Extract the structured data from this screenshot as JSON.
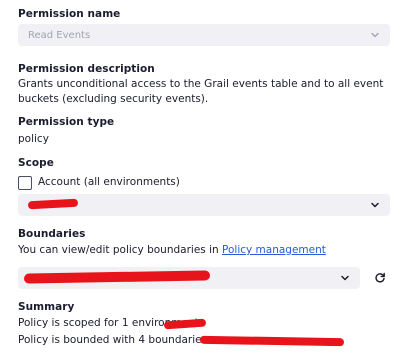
{
  "permission_name": {
    "label": "Permission name",
    "value": "Read Events"
  },
  "permission_description": {
    "label": "Permission description",
    "text": "Grants unconditional access to the Grail events table and to all event buckets (excluding security events)."
  },
  "permission_type": {
    "label": "Permission type",
    "value": "policy"
  },
  "scope": {
    "label": "Scope",
    "checkbox_label": "Account (all environments)",
    "checked": false
  },
  "boundaries": {
    "label": "Boundaries",
    "text_prefix": "You can view/edit policy boundaries in ",
    "link_text": "Policy management"
  },
  "summary": {
    "label": "Summary",
    "line1": "Policy is scoped for 1 environment:",
    "line2": "Policy is bounded with 4 boundaries:"
  },
  "icons": {
    "dropdown": "chevron-down-icon",
    "refresh": "refresh-icon"
  },
  "colors": {
    "link": "#2b58d6",
    "redaction": "#e8141b",
    "select_bg": "#f0f0f5"
  }
}
